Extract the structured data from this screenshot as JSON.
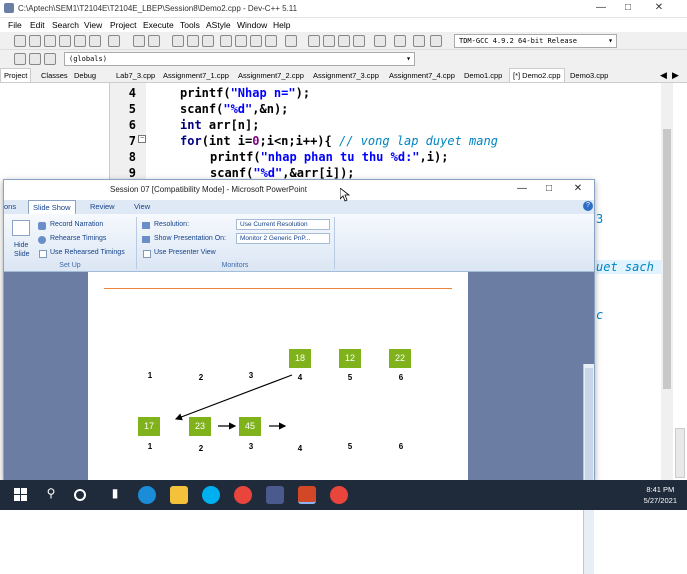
{
  "devcpp": {
    "title": "C:\\Aptech\\SEM1\\T2104E\\T2104E_LBEP\\Session8\\Demo2.cpp - Dev-C++ 5.11",
    "menu": [
      "File",
      "Edit",
      "Search",
      "View",
      "Project",
      "Execute",
      "Tools",
      "AStyle",
      "Window",
      "Help"
    ],
    "compiler": "TDM-GCC 4.9.2 64-bit Release",
    "scope": "(globals)",
    "left_tabs": [
      "Project",
      "Classes",
      "Debug"
    ],
    "file_tabs": [
      "Lab7_3.cpp",
      "Assignment7_1.cpp",
      "Assignment7_2.cpp",
      "Assignment7_3.cpp",
      "Assignment7_4.cpp",
      "Demo1.cpp",
      "[*] Demo2.cpp",
      "Demo3.cpp"
    ],
    "line_numbers": [
      "4",
      "5",
      "6",
      "7",
      "8",
      "9"
    ],
    "code": {
      "l4a": "printf(",
      "l4b": "\"Nhap n=\"",
      "l4c": ");",
      "l5a": "scanf(",
      "l5b": "\"%d\"",
      "l5c": ",&n);",
      "l6a": "int ",
      "l6b": "arr[n];",
      "l7a": "for",
      "l7b": "(int i=",
      "l7c": "0",
      "l7d": ";i<n;i++){ ",
      "l7e": "// vong lap duyet mang",
      "l8a": "printf(",
      "l8b": "\"nhap phan tu thu %d:\"",
      "l8c": ",i);",
      "l9a": "scanf(",
      "l9b": "\"%d\"",
      "l9c": ",&arr[i]);"
    },
    "partial_text": {
      "p1": "3",
      "p2": "uet sach",
      "p3": "c"
    }
  },
  "ppt": {
    "title": "Session 07 [Compatibility Mode] - Microsoft PowerPoint",
    "tabs": [
      "ons",
      "Slide Show",
      "Review",
      "View"
    ],
    "setup": {
      "hide_label": "Hide",
      "slide_label": "Slide",
      "record": "Record Narration",
      "rehearse": "Rehearse Timings",
      "use_rehearsed": "Use Rehearsed Timings",
      "group": "Set Up"
    },
    "monitors": {
      "resolution_label": "Resolution:",
      "resolution_value": "Use Current Resolution",
      "show_on_label": "Show Presentation On:",
      "show_on_value": "Monitor 2 Generic PnP...",
      "presenter_view": "Use Presenter View",
      "group": "Monitors"
    },
    "slide": {
      "top_boxes": [
        "18",
        "12",
        "22"
      ],
      "top_indices": [
        "1",
        "2",
        "3",
        "4",
        "5",
        "6"
      ],
      "bottom_boxes": [
        "17",
        "23",
        "45"
      ],
      "bottom_indices": [
        "1",
        "2",
        "3",
        "4",
        "5",
        "6"
      ]
    }
  },
  "taskbar": {
    "time": "8:41 PM",
    "date": "5/27/2021"
  }
}
